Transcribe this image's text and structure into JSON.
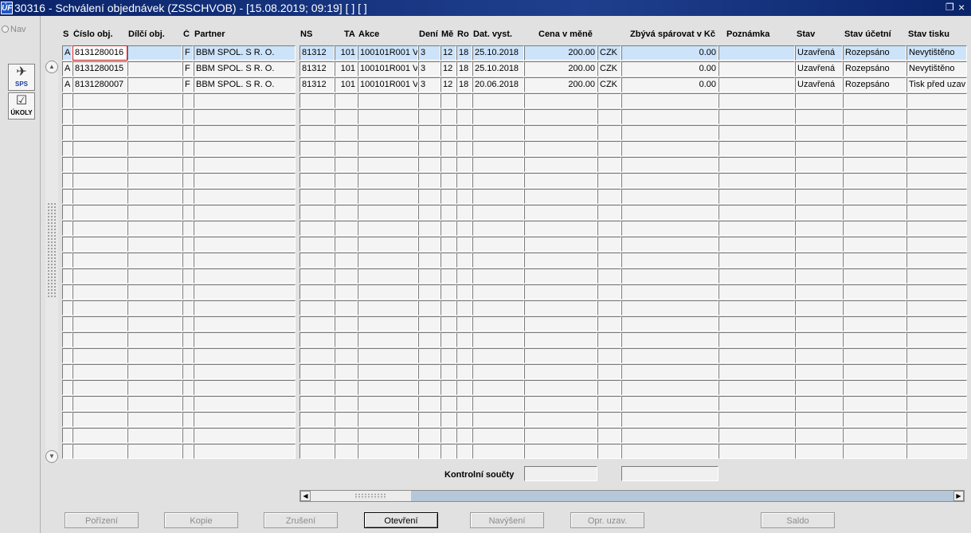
{
  "window": {
    "title": "30316 - Schválení objednávek (ZSSCHVOB) - [15.08.2019; 09:19]  [ ]  [ ]",
    "app_icon_text": "ÚF"
  },
  "left_toolbar": {
    "nav_label": "Nav",
    "sps_label": "SPS",
    "ukoly_label": "ÚKOLY"
  },
  "columns": [
    {
      "key": "s",
      "label": "S"
    },
    {
      "key": "cislo",
      "label": "Číslo obj."
    },
    {
      "key": "dilci",
      "label": "Dílčí obj."
    },
    {
      "key": "c",
      "label": "Č"
    },
    {
      "key": "partner",
      "label": "Partner"
    },
    {
      "key": "ns",
      "label": "NS"
    },
    {
      "key": "ta",
      "label": "TA"
    },
    {
      "key": "akce",
      "label": "Akce"
    },
    {
      "key": "den",
      "label": "Dení"
    },
    {
      "key": "me",
      "label": "Mě"
    },
    {
      "key": "ro",
      "label": "Ro"
    },
    {
      "key": "dat",
      "label": "Dat. vyst."
    },
    {
      "key": "cena",
      "label": "Cena v měně"
    },
    {
      "key": "mena",
      "label": ""
    },
    {
      "key": "zbyva",
      "label": "Zbývá spárovat v Kč"
    },
    {
      "key": "pozn",
      "label": "Poznámka"
    },
    {
      "key": "stav",
      "label": "Stav"
    },
    {
      "key": "stavu",
      "label": "Stav účetní"
    },
    {
      "key": "stavt",
      "label": "Stav tisku"
    }
  ],
  "rows": [
    {
      "s": "A",
      "cislo": "8131280016",
      "dilci": "",
      "c": "F",
      "partner": "BBM SPOL. S R. O.",
      "ns": "81312",
      "ta": "101",
      "akce": "100101R001 V",
      "den": "3",
      "me": "12",
      "ro": "18",
      "dat": "25.10.2018",
      "cena": "200.00",
      "mena": "CZK",
      "zbyva": "0.00",
      "pozn": "",
      "stav": "Uzavřená",
      "stavu": "Rozepsáno",
      "stavt": "Nevytištěno"
    },
    {
      "s": "A",
      "cislo": "8131280015",
      "dilci": "",
      "c": "F",
      "partner": "BBM SPOL. S R. O.",
      "ns": "81312",
      "ta": "101",
      "akce": "100101R001 V",
      "den": "3",
      "me": "12",
      "ro": "18",
      "dat": "25.10.2018",
      "cena": "200.00",
      "mena": "CZK",
      "zbyva": "0.00",
      "pozn": "",
      "stav": "Uzavřená",
      "stavu": "Rozepsáno",
      "stavt": "Nevytištěno"
    },
    {
      "s": "A",
      "cislo": "8131280007",
      "dilci": "",
      "c": "F",
      "partner": "BBM SPOL. S R. O.",
      "ns": "81312",
      "ta": "101",
      "akce": "100101R001 V",
      "den": "3",
      "me": "12",
      "ro": "18",
      "dat": "20.06.2018",
      "cena": "200.00",
      "mena": "CZK",
      "zbyva": "0.00",
      "pozn": "",
      "stav": "Uzavřená",
      "stavu": "Rozepsáno",
      "stavt": "Tisk před uzav"
    }
  ],
  "summary": {
    "label": "Kontrolní součty",
    "cena_total": "",
    "zbyva_total": ""
  },
  "buttons": {
    "porizeni": "Pořízení",
    "kopie": "Kopie",
    "zruseni": "Zrušení",
    "otevreni": "Otevření",
    "navyseni": "Navýšení",
    "opr_uzav": "Opr. uzav.",
    "saldo": "Saldo"
  }
}
